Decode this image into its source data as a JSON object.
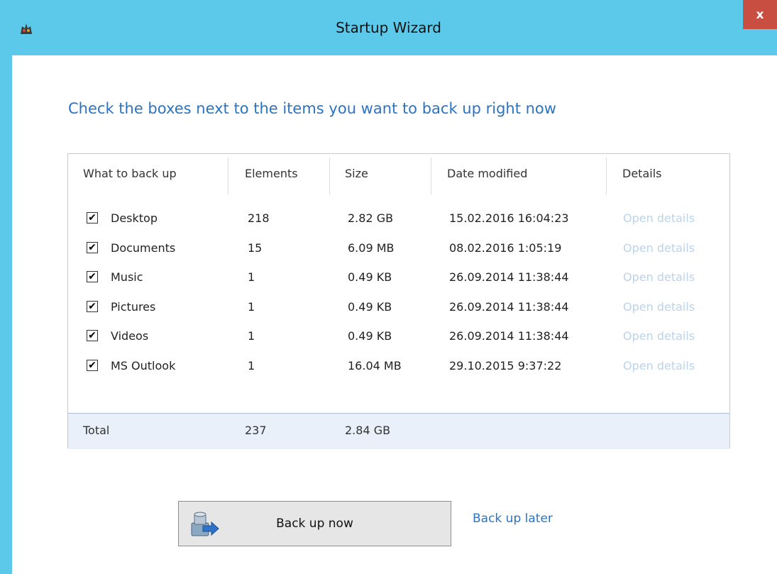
{
  "window": {
    "title": "Startup Wizard",
    "close_label": "x"
  },
  "heading": "Check the boxes next to the items you want to back up right now",
  "table": {
    "columns": [
      "What to back up",
      "Elements",
      "Size",
      "Date modified",
      "Details"
    ],
    "rows": [
      {
        "checked": true,
        "name": "Desktop",
        "elements": "218",
        "size": "2.82 GB",
        "date": "15.02.2016 16:04:23",
        "details": "Open details"
      },
      {
        "checked": true,
        "name": "Documents",
        "elements": "15",
        "size": "6.09 MB",
        "date": "08.02.2016 1:05:19",
        "details": "Open details"
      },
      {
        "checked": true,
        "name": "Music",
        "elements": "1",
        "size": "0.49 KB",
        "date": "26.09.2014 11:38:44",
        "details": "Open details"
      },
      {
        "checked": true,
        "name": "Pictures",
        "elements": "1",
        "size": "0.49 KB",
        "date": "26.09.2014 11:38:44",
        "details": "Open details"
      },
      {
        "checked": true,
        "name": "Videos",
        "elements": "1",
        "size": "0.49 KB",
        "date": "26.09.2014 11:38:44",
        "details": "Open details"
      },
      {
        "checked": true,
        "name": "MS Outlook",
        "elements": "1",
        "size": "16.04 MB",
        "date": "29.10.2015 9:37:22",
        "details": "Open details"
      }
    ],
    "total": {
      "label": "Total",
      "elements": "237",
      "size": "2.84 GB"
    }
  },
  "buttons": {
    "backup_now": "Back up now",
    "backup_later": "Back up later"
  },
  "colors": {
    "titlebar": "#5dc9ea",
    "accent": "#2a73c5",
    "close": "#c74e40",
    "disabled_link": "#bcd3ea"
  },
  "icons": {
    "app": "app-logo-icon",
    "backup": "backup-drive-icon",
    "checkbox_mark": "✔"
  }
}
